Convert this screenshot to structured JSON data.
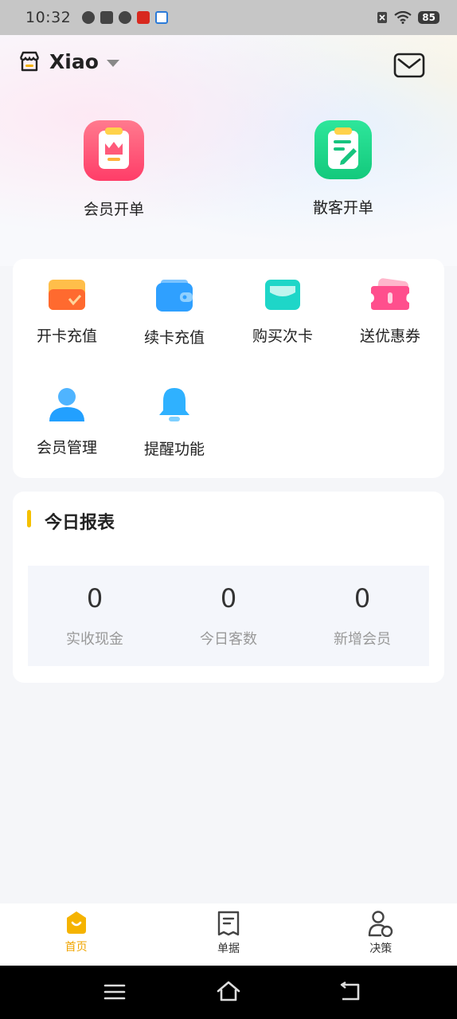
{
  "status_bar": {
    "time": "10:32",
    "battery": "85"
  },
  "header": {
    "store_name": "Xiao"
  },
  "primary_actions": [
    {
      "label": "会员开单",
      "icon": "member-order-icon",
      "color": "#ff5a7a"
    },
    {
      "label": "散客开单",
      "icon": "guest-order-icon",
      "color": "#1ed48a"
    }
  ],
  "functions": [
    {
      "label": "开卡充值",
      "icon": "open-card-icon"
    },
    {
      "label": "续卡充值",
      "icon": "wallet-icon"
    },
    {
      "label": "购买次卡",
      "icon": "card-icon"
    },
    {
      "label": "送优惠券",
      "icon": "coupon-icon"
    },
    {
      "label": "会员管理",
      "icon": "user-icon"
    },
    {
      "label": "提醒功能",
      "icon": "bell-icon"
    }
  ],
  "report": {
    "title": "今日报表",
    "stats": [
      {
        "value": "0",
        "label": "实收现金"
      },
      {
        "value": "0",
        "label": "今日客数"
      },
      {
        "value": "0",
        "label": "新增会员"
      }
    ]
  },
  "tabbar": [
    {
      "label": "首页",
      "icon": "home-icon",
      "active": true
    },
    {
      "label": "单据",
      "icon": "receipt-icon",
      "active": false
    },
    {
      "label": "决策",
      "icon": "person-chart-icon",
      "active": false
    }
  ],
  "colors": {
    "accent": "#f5c000",
    "active_tab": "#f0a500"
  }
}
